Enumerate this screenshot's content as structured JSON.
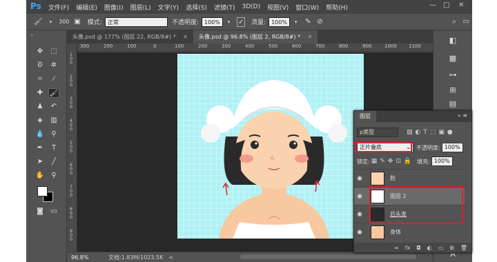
{
  "app": {
    "logo": "Ps"
  },
  "menu": [
    "文件(F)",
    "编辑(E)",
    "图像(I)",
    "图层(L)",
    "文字(Y)",
    "选择(S)",
    "滤镜(T)",
    "3D(D)",
    "视图(V)",
    "窗口(W)",
    "帮助(H)"
  ],
  "window_controls": [
    "—",
    "□",
    "✕"
  ],
  "options": {
    "brush_size": "300",
    "mode_label": "模式:",
    "mode_value": "正常",
    "opacity_label": "不透明度:",
    "opacity_value": "100%",
    "flow_label": "流量:",
    "flow_value": "100%"
  },
  "tabs": [
    {
      "label": "头像.psd @ 177% (图层 22, RGB/8#) *",
      "close": "✕"
    },
    {
      "label": "头像.psd @ 96.8% (图层 2, RGB/8#) *",
      "close": "✕"
    }
  ],
  "ruler_ticks": [
    "300",
    "200",
    "100",
    "0",
    "100",
    "200",
    "300",
    "400",
    "500",
    "600",
    "700",
    "800",
    "900",
    "1000",
    "1100"
  ],
  "ruler_v_ticks": [
    "1",
    "0",
    "0",
    "2",
    "0",
    "0",
    "3",
    "0",
    "0",
    "4",
    "0",
    "0",
    "5",
    "0",
    "0",
    "6",
    "0",
    "0",
    "7",
    "0",
    "0",
    "8",
    "0",
    "0",
    "9",
    "0",
    "0"
  ],
  "status": {
    "zoom": "96.8%",
    "doc": "文档:1.83M/1023.5K",
    "arrow": "<"
  },
  "layers_panel": {
    "title": "图层",
    "menu": "≡",
    "collapse": "»",
    "kind_label": "ρ类型",
    "blend_mode": "正片叠底",
    "opacity_label": "不透明度:",
    "opacity_value": "100%",
    "lock_label": "锁定:",
    "fill_label": "填充:",
    "fill_value": "100%",
    "layers": [
      {
        "name": "脸",
        "visible": true
      },
      {
        "name": "图层 2",
        "visible": true,
        "selected": true
      },
      {
        "name": "后头发",
        "visible": true
      },
      {
        "name": "身体",
        "visible": true
      }
    ],
    "footer_icons": [
      "link-icon",
      "fx-icon",
      "mask-icon",
      "adjustment-icon",
      "group-icon",
      "new-layer-icon",
      "trash-icon"
    ],
    "footer_labels": [
      "∞",
      "fx",
      "◘",
      "◐",
      "▭",
      "⊞",
      "🗑"
    ]
  },
  "colors": {
    "canvas_bg": "#aef1f5",
    "highlight": "#d6232a",
    "ui_dark": "#535353"
  }
}
